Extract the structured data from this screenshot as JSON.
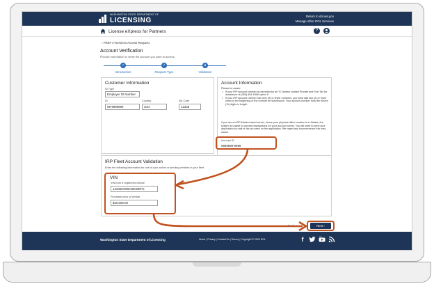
{
  "header": {
    "logo_small": "WASHINGTON STATE DEPARTMENT OF",
    "logo_big": "LICENSING",
    "link_return": "Return to dol.wa.gov",
    "link_manage": "Manage other DOL Services"
  },
  "subheader": {
    "app_title": "License eXpress for Partners",
    "help_label": "?"
  },
  "breadcrumb": "‹  FREF e-Services Access Request",
  "page": {
    "title": "Account Verification",
    "subtitle": "Provide information to verify the account you want to access."
  },
  "stepper": [
    {
      "label": "Introduction",
      "state": "complete",
      "mark": "✓"
    },
    {
      "label": "Request Type",
      "state": "complete",
      "mark": "✓"
    },
    {
      "label": "Validation",
      "state": "current",
      "mark": "●"
    }
  ],
  "customer": {
    "title": "Customer Information",
    "id_type_label": "ID Type",
    "id_type_value": "Employer ID Number",
    "id_label": "ID",
    "id_value": "99-9999999",
    "country_label": "Country",
    "country_value": "USA",
    "zip_label": "Zip Code",
    "zip_value": "12345"
  },
  "account": {
    "title": "Account Information",
    "aware": "Please be aware:",
    "bullet1": "If your IRP account number is preceded by an \"A\" please contact Prorate and Fuel Tax for assistance at (360) 664-1858 option 8",
    "bullet2": "If your IRP account number has nine (9) or fewer numbers, you must add two (2) or more zeros to the beginning of the number for submission. Your account number must be eleven (11) digits in length.",
    "note": "If you are an IRP Alaska based carrier, where your physical office location is in Alaska, the system is unable to process transactions for your account online. You will need to send your application by mail or fax as noted on the application. We regret any inconvenience this may cause.",
    "account_id_label": "Account ID",
    "account_id_value": "9999999-9999"
  },
  "fleet": {
    "title": "IRP Fleet Account Validation",
    "instruction": "Enter the following information for one of your active or pending vehicles in your fleet",
    "vin_title": "VIN",
    "vin_label": "VIN from a registered vehicle",
    "vin_value": "1234567890ABCDEFG",
    "price_label": "Purchase price of vehicle",
    "price_value": "$10,000.00"
  },
  "actions": {
    "back": "‹ Back",
    "next": "Next  ›"
  },
  "footer": {
    "org": "Washington State Department of Licensing",
    "links": "Home  |  Privacy  |  Contact Us  |  Survey  |  Copyright © 2023 DOL"
  },
  "colors": {
    "navy": "#1e3557",
    "accent": "#2f6fb6",
    "highlight": "#c0521f"
  }
}
